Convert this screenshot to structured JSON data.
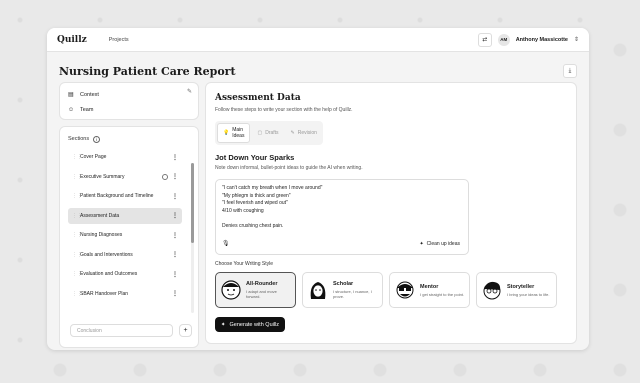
{
  "app": {
    "logo": "Quillz",
    "nav_projects": "Projects"
  },
  "user": {
    "initials": "AM",
    "name": "Anthony Massicotte"
  },
  "page": {
    "title": "Nursing Patient Care Report"
  },
  "context_menu": {
    "context": "Context",
    "team": "Team"
  },
  "sections": {
    "header": "Sections",
    "items": [
      {
        "label": "Cover Page"
      },
      {
        "label": "Executive Summary"
      },
      {
        "label": "Patient Background and Timeline"
      },
      {
        "label": "Assessment Data"
      },
      {
        "label": "Nursing Diagnoses"
      },
      {
        "label": "Goals and Interventions"
      },
      {
        "label": "Evaluation and Outcomes"
      },
      {
        "label": "SBAR Handover Plan"
      }
    ],
    "add_placeholder": "Conclusion"
  },
  "main": {
    "title": "Assessment Data",
    "subtitle": "Follow these steps to write your section with the help of Quillz.",
    "tabs": {
      "main_ideas": "Main Ideas",
      "drafts": "Drafts",
      "revision": "Revision"
    },
    "spark_title": "Jot Down Your Sparks",
    "spark_subtitle": "Note down informal, bullet-point ideas to guide the AI when writing.",
    "ideas": {
      "line1": "\"I can't catch my breath when I move around\"",
      "line2": "\"My phlegm is thick and green\"",
      "line3": "\"I feel feverish and wiped out\"",
      "line4": "4/10 with coughing",
      "line5": "Denies crushing chest pain."
    },
    "cleanup_label": "Clean up ideas",
    "style_label": "Choose Your Writing Style",
    "styles": [
      {
        "name": "All-Rounder",
        "desc": "I adapt and move forward."
      },
      {
        "name": "Scholar",
        "desc": "I structure, I nuance, I prove."
      },
      {
        "name": "Mentor",
        "desc": "I get straight to the point."
      },
      {
        "name": "Storyteller",
        "desc": "I bring your ideas to life."
      }
    ],
    "generate_label": "Generate with Quillz"
  }
}
